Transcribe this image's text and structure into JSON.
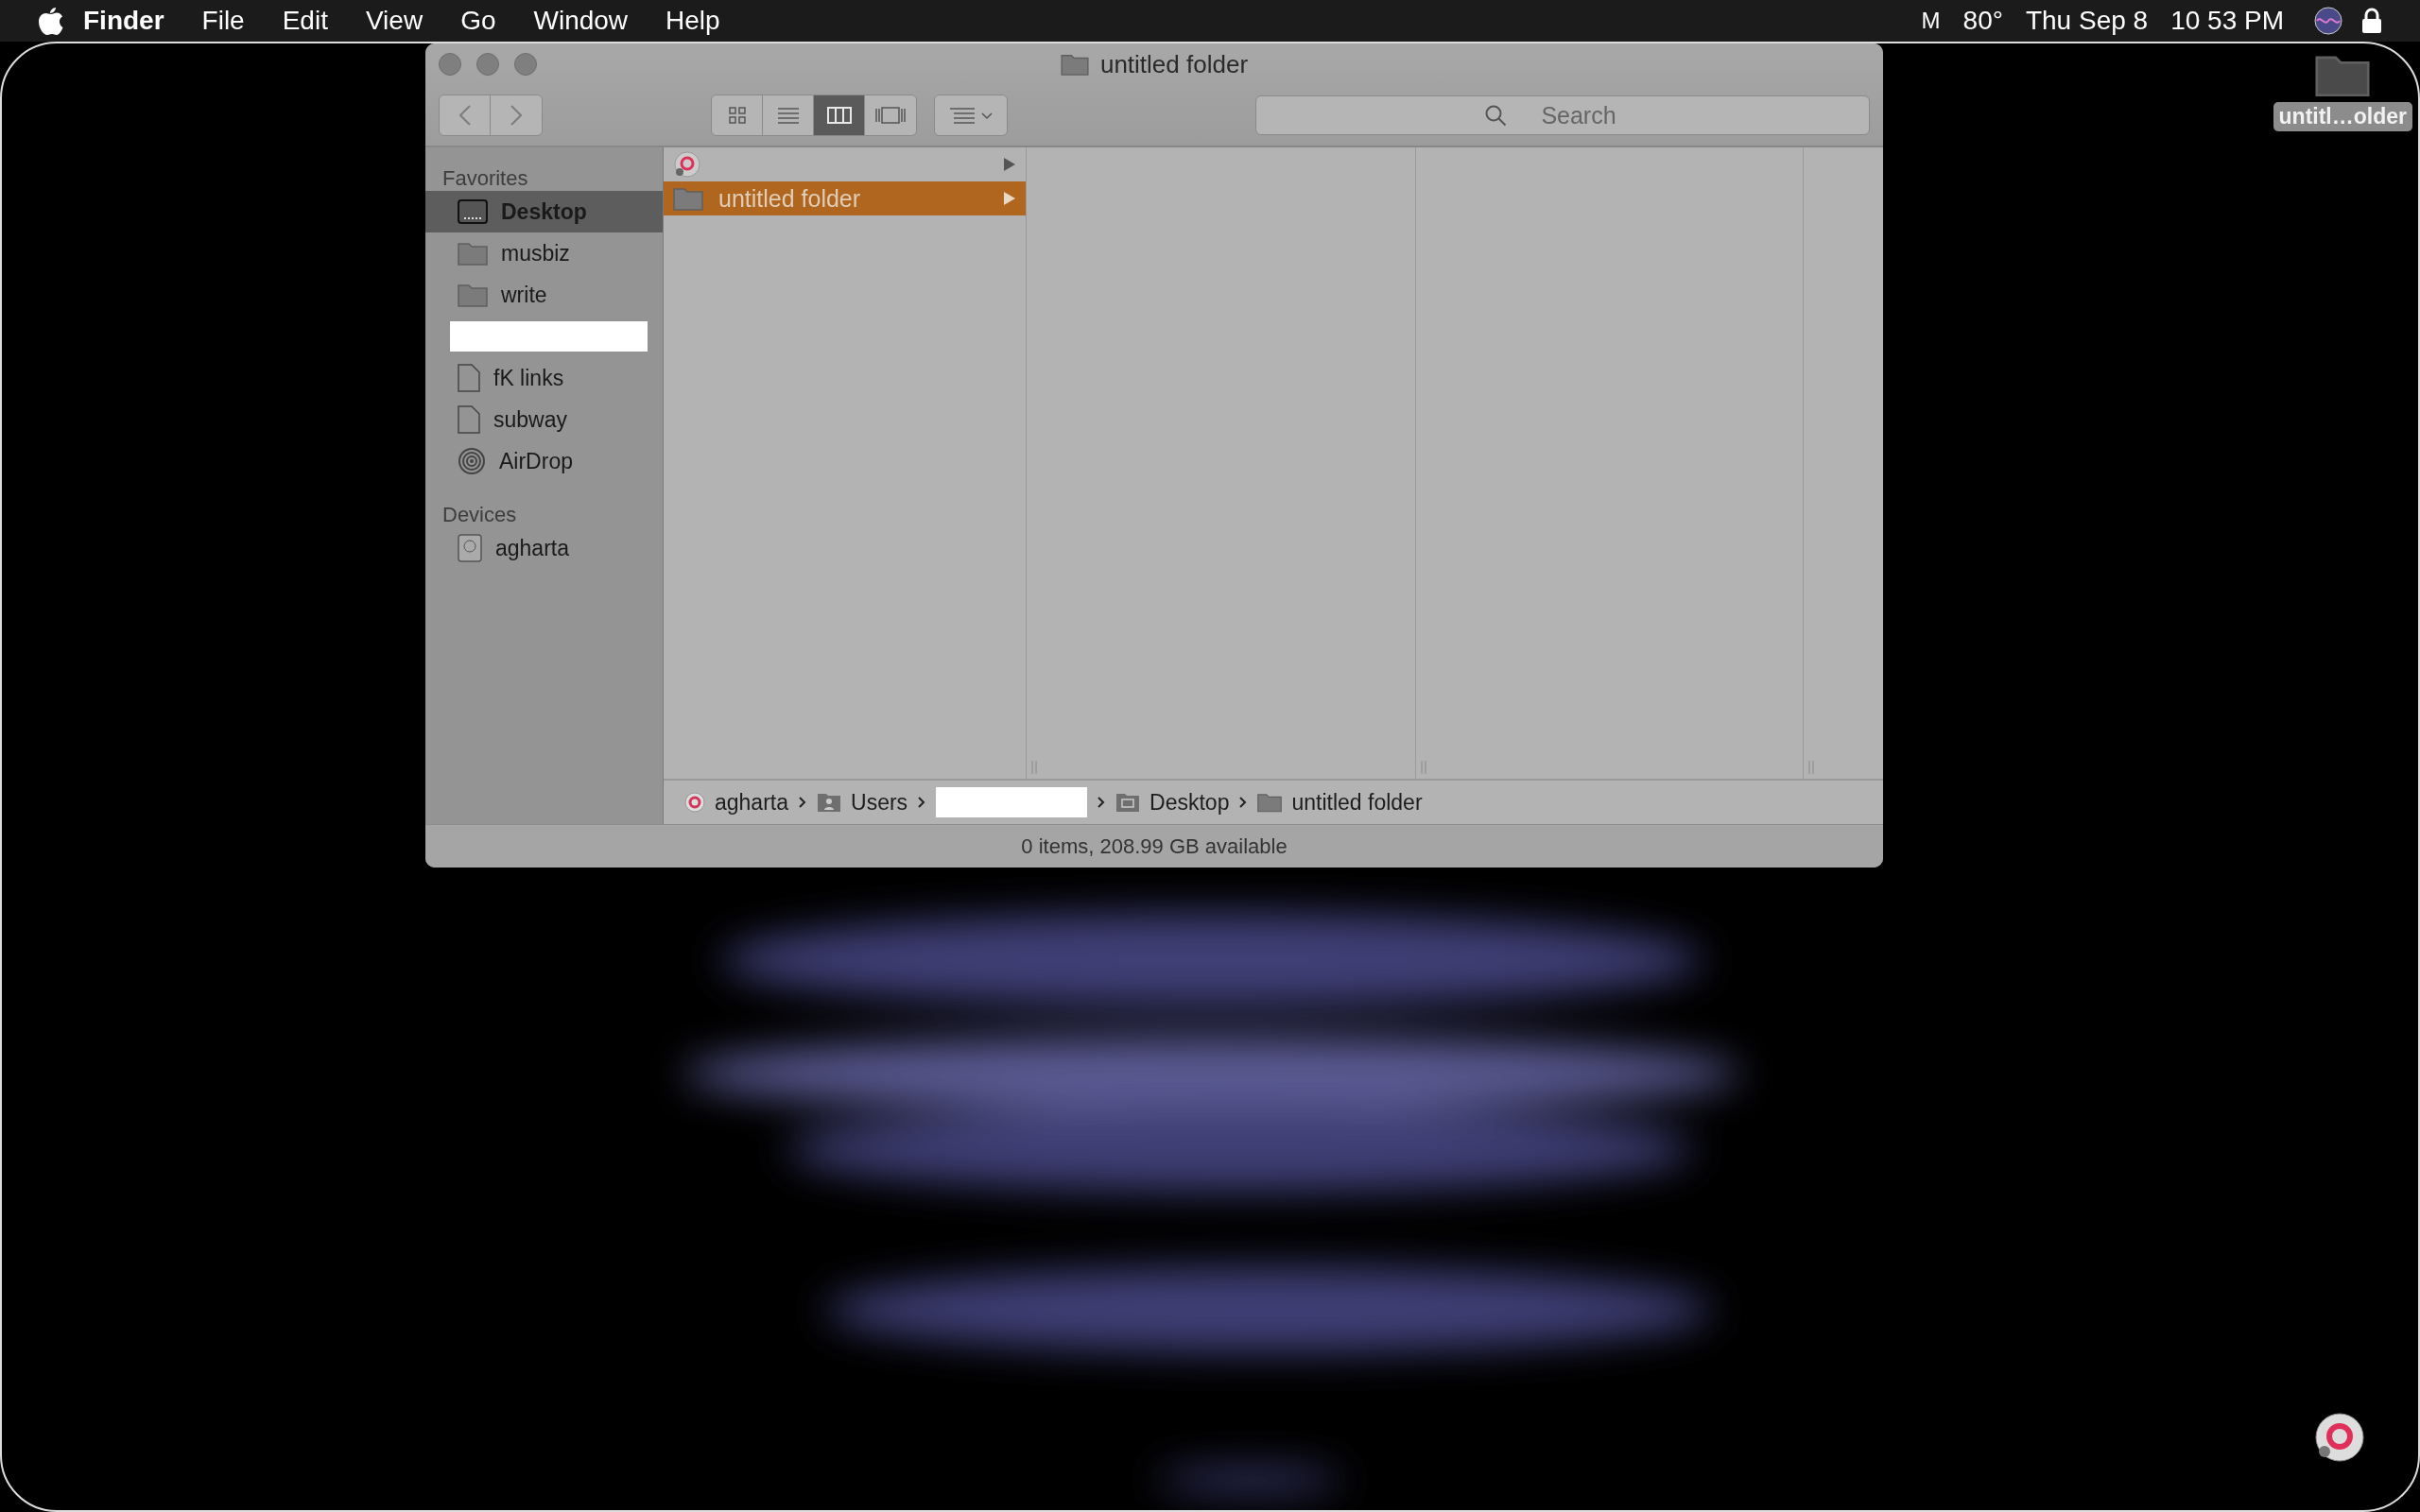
{
  "menu_bar": {
    "app": "Finder",
    "menus": [
      "File",
      "Edit",
      "View",
      "Go",
      "Window",
      "Help"
    ],
    "status": [
      "M",
      "80°",
      "Thu Sep 8",
      "10 53 PM"
    ]
  },
  "window": {
    "title": "untitled folder",
    "view_modes": [
      {
        "kind": "icon",
        "selected": false
      },
      {
        "kind": "list",
        "selected": false
      },
      {
        "kind": "column",
        "selected": true
      },
      {
        "kind": "gallery",
        "selected": false
      }
    ],
    "search": {
      "placeholder": "Search"
    },
    "sidebar": [
      {
        "title": "Favorites",
        "items": [
          {
            "kind": "desktop",
            "label": "Desktop",
            "selected": true
          },
          {
            "kind": "folder",
            "label": "musbiz",
            "selected": false
          },
          {
            "kind": "folder",
            "label": "write",
            "selected": false
          },
          {
            "kind": "redacted"
          },
          {
            "kind": "document",
            "label": "fK links",
            "selected": false
          },
          {
            "kind": "document",
            "label": "subway",
            "selected": false
          },
          {
            "kind": "airdrop",
            "label": "AirDrop",
            "selected": false
          }
        ]
      },
      {
        "title": "Devices",
        "items": [
          {
            "kind": "disk",
            "label": "agharta",
            "selected": false
          }
        ]
      }
    ],
    "columns": [
      {
        "items": [
          {
            "kind": "app-alias",
            "selected": false
          },
          {
            "kind": "folder",
            "label": "untitled folder",
            "selected": true
          }
        ]
      }
    ],
    "path_bar": [
      {
        "kind": "disk",
        "label": "agharta"
      },
      {
        "kind": "users",
        "label": "Users"
      },
      {
        "kind": "redacted"
      },
      {
        "kind": "desktop",
        "label": "Desktop"
      },
      {
        "kind": "folder",
        "label": "untitled folder"
      }
    ],
    "status_bar": "0 items, 208.99 GB available"
  },
  "desktop_icons": [
    {
      "kind": "folder",
      "label": "untitl…older"
    }
  ]
}
